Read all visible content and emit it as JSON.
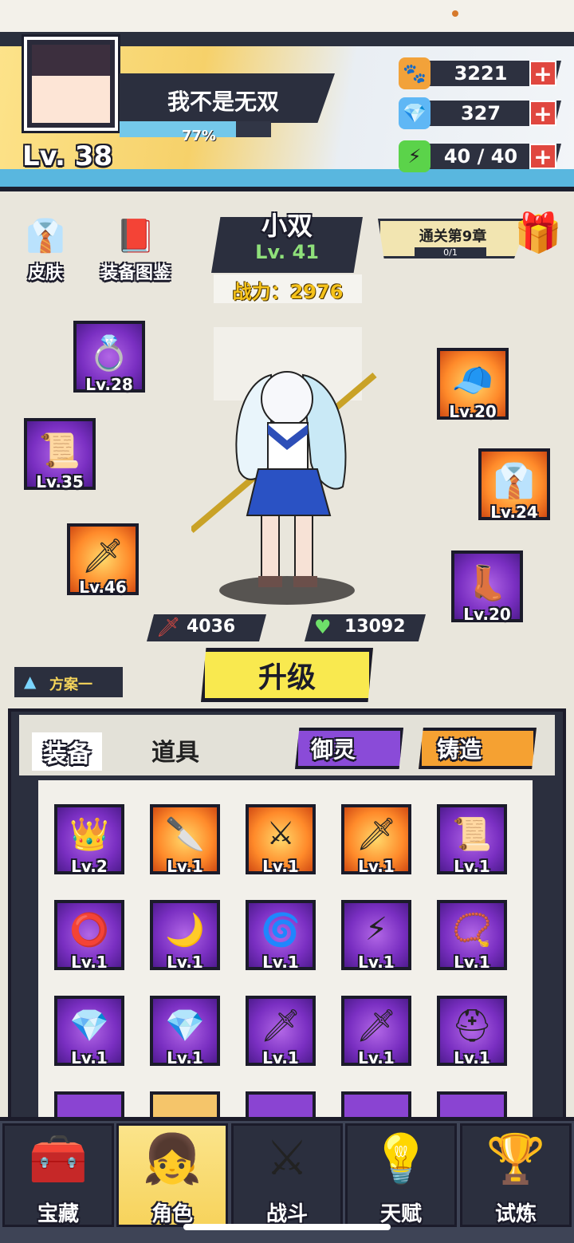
{
  "player": {
    "name": "我不是无双",
    "level": "Lv. 38",
    "exp_percent": "77%",
    "exp_fraction": 0.77
  },
  "currencies": [
    {
      "name": "paw-coin",
      "icon": "paw-icon",
      "value": "3221",
      "color": "#f2a23a"
    },
    {
      "name": "diamond",
      "icon": "diamond-icon",
      "value": "327",
      "color": "#5fb7f5"
    },
    {
      "name": "energy",
      "icon": "lightning-icon",
      "value": "40 / 40",
      "color": "#5bd34a"
    }
  ],
  "left_menu": [
    {
      "label": "皮肤",
      "icon": "uniform-icon"
    },
    {
      "label": "装备图鉴",
      "icon": "book-icon"
    }
  ],
  "character": {
    "name": "小双",
    "level": "Lv. 41",
    "power": "战力：2976",
    "attack": "4036",
    "hp": "13092"
  },
  "chapter": {
    "title": "通关第9章",
    "progress": "0/1"
  },
  "equipment_slots": [
    {
      "name": "slot-ring",
      "level": "Lv.28",
      "rarity": "purple",
      "icon": "ring-icon",
      "glyph": "💍"
    },
    {
      "name": "slot-scroll",
      "level": "Lv.35",
      "rarity": "purple",
      "icon": "scroll-icon",
      "glyph": "📜"
    },
    {
      "name": "slot-weapon",
      "level": "Lv.46",
      "rarity": "orange",
      "icon": "sword-icon",
      "glyph": "🗡"
    },
    {
      "name": "slot-hat",
      "level": "Lv.20",
      "rarity": "orange",
      "icon": "cap-icon",
      "glyph": "🧢"
    },
    {
      "name": "slot-uniform",
      "level": "Lv.24",
      "rarity": "orange",
      "icon": "uniform-icon",
      "glyph": "👔"
    },
    {
      "name": "slot-boots",
      "level": "Lv.20",
      "rarity": "purple",
      "icon": "boot-icon",
      "glyph": "👢"
    }
  ],
  "upgrade_label": "升级",
  "plan_label": "方案一",
  "tabs": {
    "equipment": "装备",
    "items": "道具",
    "spirit": "御灵",
    "forge": "铸造"
  },
  "inventory": [
    {
      "level": "Lv.2",
      "rarity": "purple",
      "icon": "tiara-icon",
      "glyph": "👑"
    },
    {
      "level": "Lv.1",
      "rarity": "orange",
      "icon": "blade-icon",
      "glyph": "🔪"
    },
    {
      "level": "Lv.1",
      "rarity": "orange",
      "icon": "sword-icon",
      "glyph": "⚔"
    },
    {
      "level": "Lv.1",
      "rarity": "orange",
      "icon": "blade-icon",
      "glyph": "🗡"
    },
    {
      "level": "Lv.1",
      "rarity": "purple",
      "icon": "scroll-icon",
      "glyph": "📜"
    },
    {
      "level": "Lv.1",
      "rarity": "purple",
      "icon": "ring-icon",
      "glyph": "⭕"
    },
    {
      "level": "Lv.1",
      "rarity": "purple",
      "icon": "ring-icon",
      "glyph": "🌙"
    },
    {
      "level": "Lv.1",
      "rarity": "purple",
      "icon": "ring-icon",
      "glyph": "🌀"
    },
    {
      "level": "Lv.1",
      "rarity": "purple",
      "icon": "pendant-icon",
      "glyph": "⚡"
    },
    {
      "level": "Lv.1",
      "rarity": "purple",
      "icon": "necklace-icon",
      "glyph": "📿"
    },
    {
      "level": "Lv.1",
      "rarity": "purple",
      "icon": "amulet-icon",
      "glyph": "💎"
    },
    {
      "level": "Lv.1",
      "rarity": "purple",
      "icon": "amulet-icon",
      "glyph": "💎"
    },
    {
      "level": "Lv.1",
      "rarity": "purple",
      "icon": "dagger-icon",
      "glyph": "🗡"
    },
    {
      "level": "Lv.1",
      "rarity": "purple",
      "icon": "dagger-icon",
      "glyph": "🗡"
    },
    {
      "level": "Lv.1",
      "rarity": "purple",
      "icon": "helmet-icon",
      "glyph": "⛑"
    }
  ],
  "bottom_nav": [
    {
      "label": "宝藏",
      "icon": "treasure-chest-icon",
      "glyph": "🧰",
      "active": false
    },
    {
      "label": "角色",
      "icon": "character-icon",
      "glyph": "👧",
      "active": true
    },
    {
      "label": "战斗",
      "icon": "crossed-swords-icon",
      "glyph": "⚔",
      "active": false
    },
    {
      "label": "天赋",
      "icon": "lightbulb-icon",
      "glyph": "💡",
      "active": false
    },
    {
      "label": "试炼",
      "icon": "emblem-icon",
      "glyph": "🏆",
      "active": false
    }
  ]
}
